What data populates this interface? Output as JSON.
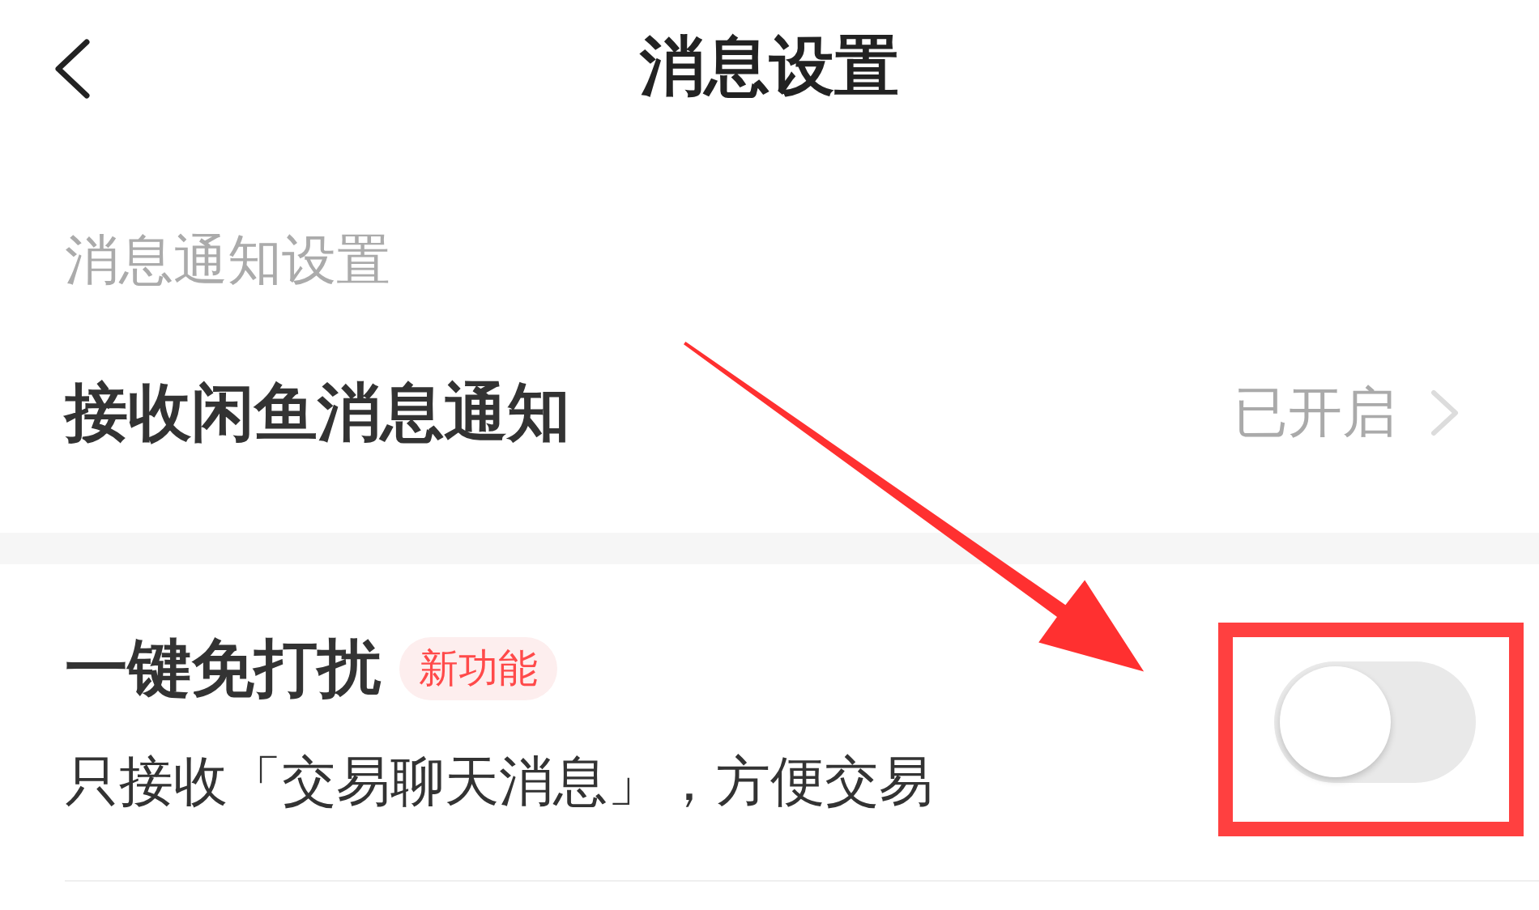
{
  "header": {
    "title": "消息设置"
  },
  "sections": [
    {
      "title": "消息通知设置",
      "items": [
        {
          "kind": "link",
          "label": "接收闲鱼消息通知",
          "value": "已开启"
        }
      ]
    },
    {
      "items": [
        {
          "kind": "toggle",
          "label": "一键免打扰",
          "badge": "新功能",
          "description": "只接收「交易聊天消息」，方便交易",
          "on": false
        }
      ]
    }
  ],
  "annotation": {
    "arrow": true,
    "highlight_frame": true
  }
}
